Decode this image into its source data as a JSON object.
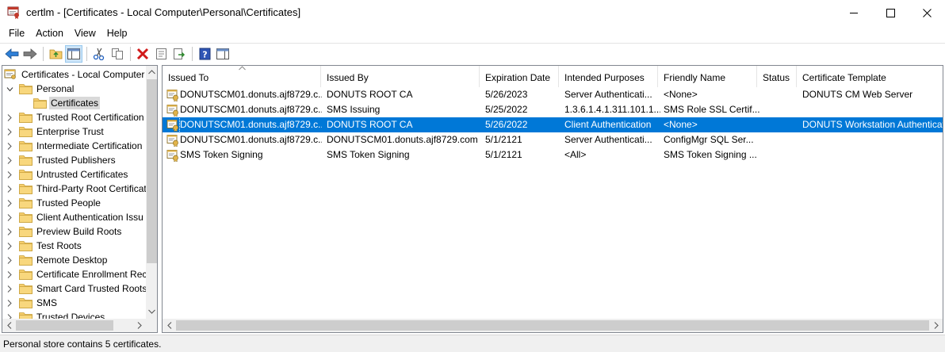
{
  "window": {
    "title": "certlm - [Certificates - Local Computer\\Personal\\Certificates]"
  },
  "menu": [
    {
      "label": "File"
    },
    {
      "label": "Action"
    },
    {
      "label": "View"
    },
    {
      "label": "Help"
    }
  ],
  "tree": {
    "root": "Certificates - Local Computer",
    "personal": "Personal",
    "certificates": "Certificates",
    "stores": [
      "Trusted Root Certification",
      "Enterprise Trust",
      "Intermediate Certification",
      "Trusted Publishers",
      "Untrusted Certificates",
      "Third-Party Root Certificat",
      "Trusted People",
      "Client Authentication Issu",
      "Preview Build Roots",
      "Test Roots",
      "Remote Desktop",
      "Certificate Enrollment Rec",
      "Smart Card Trusted Roots",
      "SMS",
      "Trusted Devices"
    ]
  },
  "list": {
    "columns": [
      "Issued To",
      "Issued By",
      "Expiration Date",
      "Intended Purposes",
      "Friendly Name",
      "Status",
      "Certificate Template"
    ],
    "rows": [
      [
        "DONUTSCM01.donuts.ajf8729.c...",
        "DONUTS ROOT CA",
        "5/26/2023",
        "Server Authenticati...",
        "<None>",
        "",
        "DONUTS CM Web Server"
      ],
      [
        "DONUTSCM01.donuts.ajf8729.c...",
        "SMS Issuing",
        "5/25/2022",
        "1.3.6.1.4.1.311.101.1...",
        "SMS Role SSL Certif...",
        "",
        ""
      ],
      [
        "DONUTSCM01.donuts.ajf8729.c...",
        "DONUTS ROOT CA",
        "5/26/2022",
        "Client Authentication",
        "<None>",
        "",
        "DONUTS Workstation Authenticat"
      ],
      [
        "DONUTSCM01.donuts.ajf8729.c...",
        "DONUTSCM01.donuts.ajf8729.com",
        "5/1/2121",
        "Server Authenticati...",
        "ConfigMgr SQL Ser...",
        "",
        ""
      ],
      [
        "SMS Token Signing",
        "SMS Token Signing",
        "5/1/2121",
        "<All>",
        "SMS Token Signing ...",
        "",
        ""
      ]
    ],
    "selected_row": 2
  },
  "status": {
    "text": "Personal store contains 5 certificates."
  },
  "colors": {
    "selection": "#0078d7",
    "folder": "#f5cd6b"
  }
}
